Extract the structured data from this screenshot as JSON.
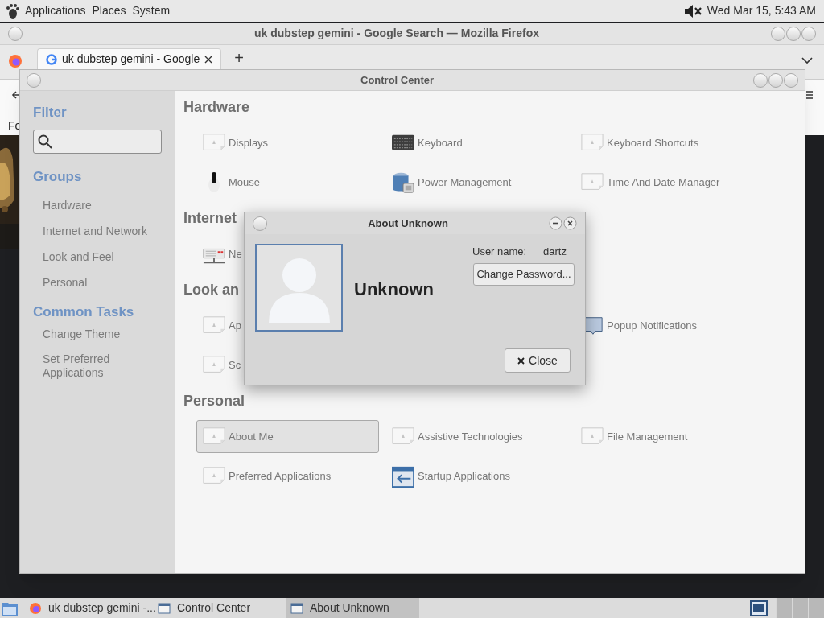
{
  "top_panel": {
    "menus": [
      "Applications",
      "Places",
      "System"
    ],
    "clock": "Wed Mar 15, 5:43 AM"
  },
  "browser": {
    "title": "uk dubstep gemini - Google Search — Mozilla Firefox",
    "tabs": [
      {
        "label": "uk dubstep gemini - Google",
        "selected": true
      }
    ],
    "new_tab": "+",
    "bookmark_fragment": "Fo"
  },
  "control_center": {
    "title": "Control Center",
    "sidebar": {
      "filter_heading": "Filter",
      "groups_heading": "Groups",
      "groups": [
        "Hardware",
        "Internet and Network",
        "Look and Feel",
        "Personal"
      ],
      "tasks_heading": "Common Tasks",
      "tasks": [
        "Change Theme",
        "Set Preferred Applications"
      ]
    },
    "sections": [
      {
        "heading": "Hardware",
        "rows": [
          [
            {
              "label": "Displays",
              "kind": "generic",
              "selected": false
            },
            {
              "label": "Keyboard",
              "kind": "keyboard",
              "selected": false
            },
            {
              "label": "Keyboard Shortcuts",
              "kind": "generic",
              "selected": false
            }
          ],
          [
            {
              "label": "Mouse",
              "kind": "mouse",
              "selected": false
            },
            {
              "label": "Power Management",
              "kind": "power",
              "selected": false
            },
            {
              "label": "Time And Date Manager",
              "kind": "generic",
              "selected": false
            }
          ]
        ]
      },
      {
        "heading": "Internet",
        "rows": [
          [
            {
              "label": "Ne",
              "kind": "network",
              "selected": false
            },
            null,
            null
          ]
        ]
      },
      {
        "heading": "Look an",
        "rows": [
          [
            {
              "label": "Ap",
              "kind": "generic",
              "selected": false
            },
            null,
            {
              "label": "Popup Notifications",
              "kind": "bubble",
              "selected": false
            }
          ],
          [
            {
              "label": "Sc",
              "kind": "generic",
              "selected": false
            },
            null,
            null
          ]
        ]
      },
      {
        "heading": "Personal",
        "rows": [
          [
            {
              "label": "About Me",
              "kind": "generic",
              "selected": true
            },
            {
              "label": "Assistive Technologies",
              "kind": "generic",
              "selected": false
            },
            {
              "label": "File Management",
              "kind": "generic",
              "selected": false
            }
          ],
          [
            {
              "label": "Preferred Applications",
              "kind": "generic",
              "selected": false
            },
            {
              "label": "Startup Applications",
              "kind": "startup",
              "selected": false
            },
            null
          ]
        ]
      }
    ]
  },
  "dialog": {
    "title": "About Unknown",
    "name": "Unknown",
    "user_label": "User name:",
    "user_value": "dartz",
    "change_button": "Change Password...",
    "close_button": "Close"
  },
  "taskbar": {
    "items": [
      {
        "label": "uk dubstep gemini -...",
        "kind": "browser",
        "selected": false
      },
      {
        "label": "Control Center",
        "kind": "window",
        "selected": false
      },
      {
        "label": "About Unknown",
        "kind": "window",
        "selected": true
      }
    ]
  }
}
